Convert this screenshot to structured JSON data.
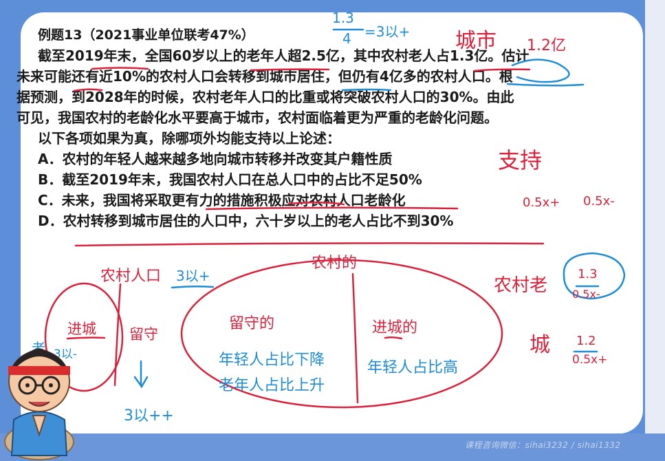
{
  "question": {
    "title": "例题13（2021事业单位联考47%）",
    "paragraph_lines": [
      "截至2019年末，全国60岁以上的老年人超2.5亿，其中农村老人占1.3亿。估计",
      "未来可能还有近10%的农村人口会转移到城市居住，但仍有4亿多的农村人口。根",
      "据预测，到2028年的时候，农村老年人口的比重或将突破农村人口的30%。由此",
      "可见，我国农村的老龄化水平要高于城市，农村面临着更为严重的老龄化问题。"
    ],
    "prompt": "以下各项如果为真，除哪项外均能支持以上论述：",
    "options": [
      "A．农村的年轻人越来越多地向城市转移并改变其户籍性质",
      "B．截至2019年末，我国农村人口在总人口中的占比不足50%",
      "C．未来，我国将采取更有力的措施积极应对农村人口老龄化",
      "D．农村转移到城市居住的人口中，六十岁以上的老人占比不到30%"
    ]
  },
  "annotations": {
    "top_fraction_num": "1.3",
    "top_fraction_den": "4",
    "top_fraction_result": "=3以+",
    "city_word": "城市",
    "city_value": "1.2亿",
    "support": "支持",
    "half_a": "0.5x+",
    "half_b": "0.5x-",
    "rural_aged_label": "农村老",
    "rural_frac_num": "1.3",
    "rural_frac_den": "0.5x-",
    "city_label": "城",
    "city_frac_num": "1.2",
    "city_frac_den": "0.5x+",
    "rural_population": "农村人口",
    "rural_pop_note": "3以+",
    "enter_city": "进城",
    "stay": "留守",
    "old_small": "老",
    "old_ratio": "3以-",
    "stay_ratio": "3以++",
    "rural_of": "农村的",
    "stayed": "留守的",
    "entered_city": "进城的",
    "young_down": "年轻人占比下降",
    "old_up": "老年人占比上升",
    "young_high": "年轻人占比高"
  },
  "watermark": "课程咨询微信：sihai3232 / sihai1332",
  "colors": {
    "background": "#5d8fd8",
    "board": "#ffffff",
    "pen_red": "#d9213b",
    "pen_blue": "#1e8cd4",
    "text": "#1a1a1a"
  }
}
